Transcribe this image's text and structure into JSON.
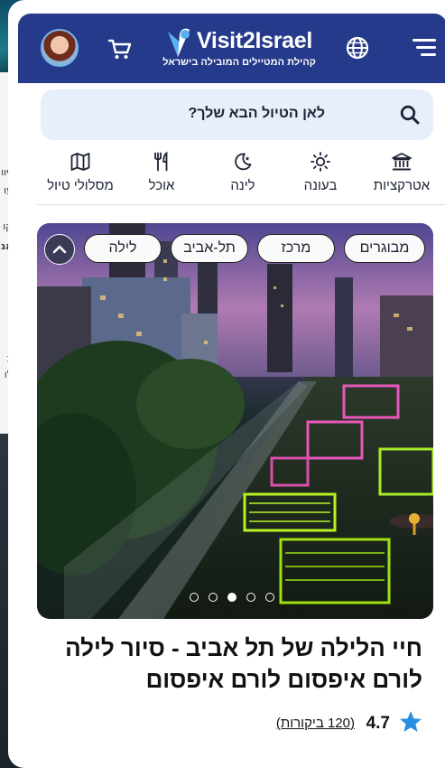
{
  "header": {
    "brand_name": "Visit2Israel",
    "brand_tagline": "קהילת המטיילים המובילה בישראל",
    "icons": {
      "menu": "hamburger-icon",
      "language": "globe-icon",
      "cart": "cart-icon",
      "profile": "avatar"
    }
  },
  "search": {
    "placeholder": "לאן הטיול הבא שלך?",
    "icon": "search-icon"
  },
  "categories": [
    {
      "label": "אטרקציות",
      "icon": "landmark-icon"
    },
    {
      "label": "בעונה",
      "icon": "sun-icon"
    },
    {
      "label": "לינה",
      "icon": "moon-star-icon"
    },
    {
      "label": "אוכל",
      "icon": "fork-knife-icon"
    },
    {
      "label": "מסלולי טיול",
      "icon": "map-icon"
    }
  ],
  "hero": {
    "tags": [
      "מבוגרים",
      "מרכז",
      "תל-אביב",
      "לילה"
    ],
    "carousel": {
      "count": 5,
      "active_index": 3
    }
  },
  "listing": {
    "title": "חיי הלילה של תל אביב - סיור לילה לורם איפסום לורם איפסום",
    "rating": "4.7",
    "reviews_text": "(120 ביקורות)"
  },
  "colors": {
    "header_bg": "#253a8a",
    "search_bg": "#e6effb",
    "star": "#2a8fe0",
    "chip_bg": "#fafafa"
  }
}
